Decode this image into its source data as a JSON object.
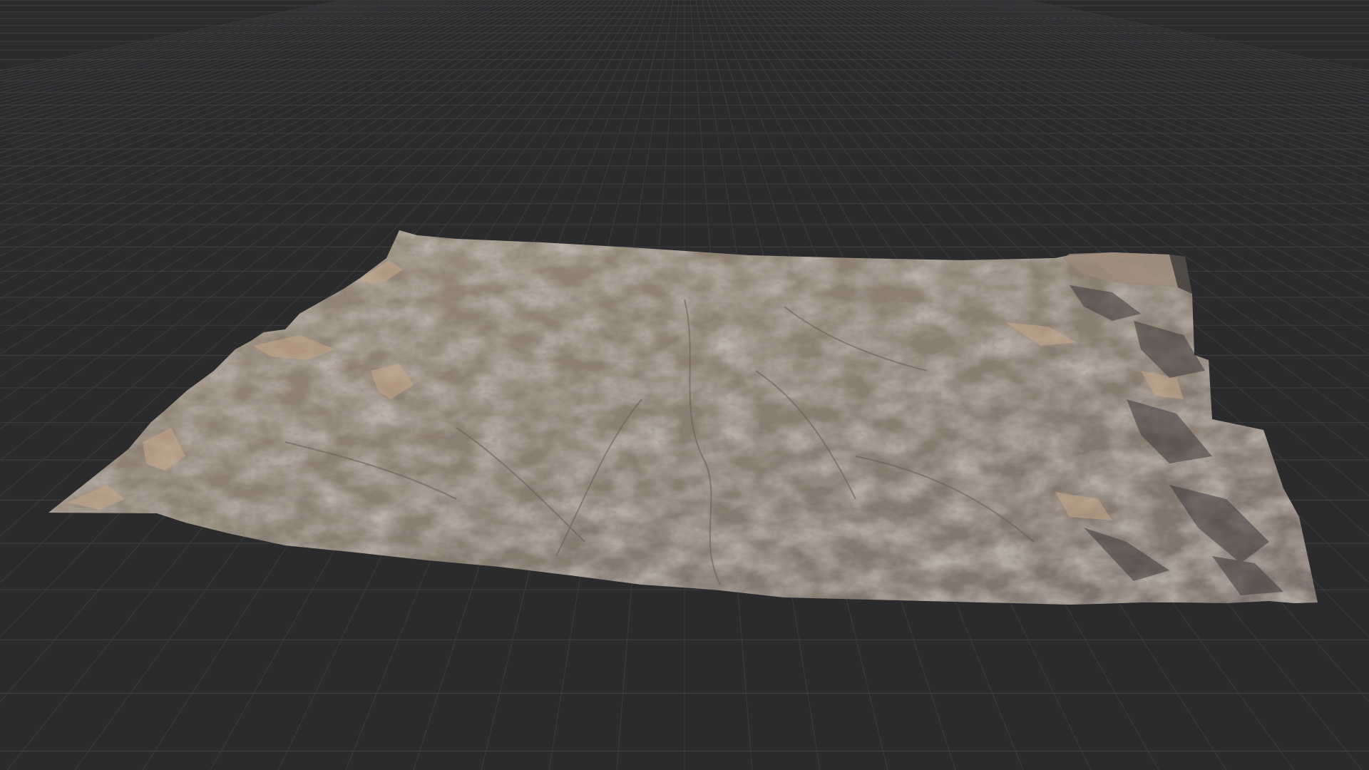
{
  "viewport": {
    "view": "3d-perspective",
    "background_color": "#2b2b2d",
    "grid_color": "#3c3c3f",
    "grid_visible": true
  },
  "terrain_mesh": {
    "material_base_color": "#8a7d71",
    "highlight_color": "#c9a889",
    "shadow_color": "#4a4644"
  }
}
